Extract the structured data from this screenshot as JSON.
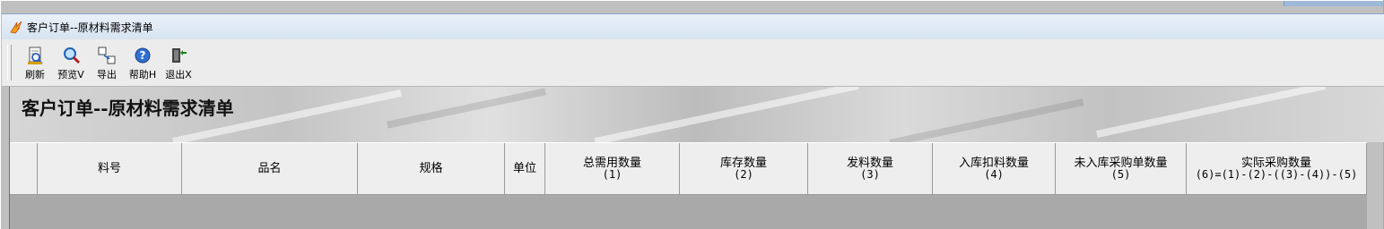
{
  "window": {
    "title": "客户订单--原材料需求清单",
    "app_icon": "flame-app-icon"
  },
  "toolbar": {
    "buttons": [
      {
        "label": "刷新",
        "icon": "refresh-page-icon"
      },
      {
        "label": "预览V",
        "icon": "magnifier-icon"
      },
      {
        "label": "导出",
        "icon": "export-icon"
      },
      {
        "label": "帮助H",
        "icon": "help-icon"
      },
      {
        "label": "退出X",
        "icon": "exit-door-icon"
      }
    ]
  },
  "banner": {
    "heading": "客户订单--原材料需求清单"
  },
  "grid": {
    "columns": [
      {
        "label": "",
        "sub": ""
      },
      {
        "label": "料号",
        "sub": ""
      },
      {
        "label": "品名",
        "sub": ""
      },
      {
        "label": "规格",
        "sub": ""
      },
      {
        "label": "单位",
        "sub": ""
      },
      {
        "label": "总需用数量",
        "sub": "(1)"
      },
      {
        "label": "库存数量",
        "sub": "(2)"
      },
      {
        "label": "发料数量",
        "sub": "(3)"
      },
      {
        "label": "入库扣料数量",
        "sub": "(4)"
      },
      {
        "label": "未入库采购单数量",
        "sub": "(5)"
      },
      {
        "label": "实际采购数量",
        "sub": "(6)=(1)-(2)-((3)-(4))-(5)"
      }
    ],
    "rows": []
  },
  "colors": {
    "window_bg": "#c0c0c0",
    "titlebar": "#dde8f4",
    "toolbar": "#ececec",
    "header": "#eeeeee",
    "empty_area": "#a9a9a9"
  }
}
